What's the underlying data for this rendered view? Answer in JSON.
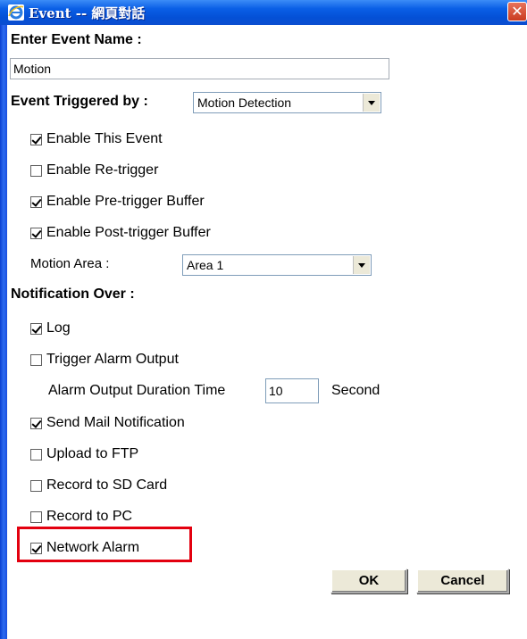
{
  "window": {
    "title": "Event -- 網頁對話",
    "title_icon": "ie-icon",
    "close_icon": "close-icon",
    "close_glyph": "✕"
  },
  "form": {
    "event_name_label": "Enter Event Name :",
    "event_name_value": "Motion",
    "triggered_by_label": "Event Triggered by :",
    "triggered_by_value": "Motion Detection",
    "trigger_options": [
      {
        "label": "Enable This Event",
        "checked": true
      },
      {
        "label": "Enable Re-trigger",
        "checked": false
      },
      {
        "label": "Enable Pre-trigger Buffer",
        "checked": true
      },
      {
        "label": "Enable Post-trigger Buffer",
        "checked": true
      }
    ],
    "motion_area_label": "Motion Area :",
    "motion_area_value": "Area 1",
    "notification_label": "Notification Over :",
    "notification_options": [
      {
        "label": "Log",
        "checked": true
      },
      {
        "label": "Trigger Alarm Output",
        "checked": false
      }
    ],
    "alarm_duration_label": "Alarm Output Duration Time",
    "alarm_duration_value": "10",
    "alarm_duration_unit": "Second",
    "more_options": [
      {
        "label": "Send Mail Notification",
        "checked": true
      },
      {
        "label": "Upload to FTP",
        "checked": false
      },
      {
        "label": "Record to SD Card",
        "checked": false
      },
      {
        "label": "Record to PC",
        "checked": false
      },
      {
        "label": "Network Alarm",
        "checked": true
      }
    ]
  },
  "buttons": {
    "ok": "OK",
    "cancel": "Cancel"
  },
  "colors": {
    "highlight": "#e3000f",
    "titlebar": "#0450d6"
  }
}
